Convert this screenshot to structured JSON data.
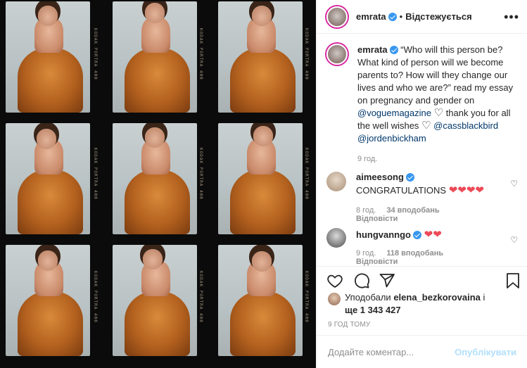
{
  "colors": {
    "link": "#00376b",
    "verified": "#3897f0",
    "heart": "#ed4956",
    "muted": "#8e8e8e",
    "post_disabled": "#b2dffc",
    "silk": "#b2601e"
  },
  "header": {
    "username": "emrata",
    "dot": "•",
    "follow_label": "Відстежується",
    "more_label": "•••"
  },
  "caption": {
    "username": "emrata",
    "text_1": "“Who will this person be? What kind of person will we become parents to? How will they change our lives and who we are?” read my essay on pregnancy and gender on",
    "mention_1": "@voguemagazine",
    "text_2": "thank you for all the well wishes",
    "mention_2": "@cassblackbird",
    "mention_3": "@jordenbickham",
    "heart_glyph": "♡",
    "time": "9 год."
  },
  "comments": [
    {
      "username": "aimeesong",
      "text": "CONGRATULATIONS",
      "hearts": "❤❤❤❤",
      "time": "8 год.",
      "likes": "34 вподобань",
      "reply": "Відповісти"
    },
    {
      "username": "hungvanngo",
      "text": "",
      "hearts": "❤❤",
      "time": "9 год.",
      "likes": "118 вподобань",
      "reply": "Відповісти"
    }
  ],
  "icons": {
    "like": "heart-outline-icon",
    "comment": "comment-icon",
    "share": "paper-plane-icon",
    "save": "bookmark-icon"
  },
  "likes": {
    "prefix": "Уподобали",
    "user": "elena_bezkorovaina",
    "suffix": "і",
    "more": "ще 1 343 427"
  },
  "post_time": "9 ГОД ТОМУ",
  "composer": {
    "placeholder": "Додайте коментар...",
    "post_label": "Опублікувати"
  },
  "contact_sheet": {
    "frames": 9,
    "edge_text": "KODAK PORTRA 400"
  }
}
